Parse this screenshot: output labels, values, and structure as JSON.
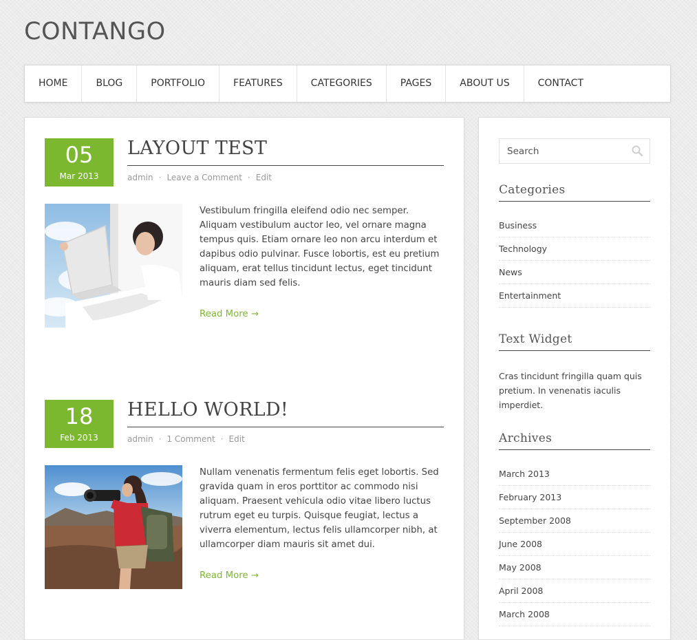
{
  "site": {
    "title": "CONTANGO"
  },
  "nav": {
    "items": [
      "HOME",
      "BLOG",
      "PORTFOLIO",
      "FEATURES",
      "CATEGORIES",
      "PAGES",
      "ABOUT US",
      "CONTACT"
    ]
  },
  "colors": {
    "accent": "#7cb82f",
    "text": "#444444",
    "background": "#ececec"
  },
  "posts": [
    {
      "day": "05",
      "month": "Mar 2013",
      "title": "LAYOUT TEST",
      "author": "admin",
      "comments": "Leave a Comment",
      "edit": "Edit",
      "excerpt": "Vestibulum fringilla eleifend odio nec semper. Aliquam vestibulum auctor leo, vel ornare magna tempus quis. Etiam ornare leo non arcu interdum et dapibus odio pulvinar. Fusce lobortis, est eu pretium aliquam, erat tellus tincidunt lectus, eget tincidunt mauris diam sed felis.",
      "read_more": "Read More →"
    },
    {
      "day": "18",
      "month": "Feb 2013",
      "title": "HELLO WORLD!",
      "author": "admin",
      "comments": "1 Comment",
      "edit": "Edit",
      "excerpt": "Nullam venenatis fermentum felis eget lobortis. Sed gravida quam in eros porttitor ac commodo nisi aliquam. Praesent vehicula odio vitae libero luctus rutrum eget eu turpis. Quisque feugiat, lectus a viverra elementum, lectus felis ullamcorper nibh, at ullamcorper diam mauris sit amet dui.",
      "read_more": "Read More →"
    }
  ],
  "sidebar": {
    "search": {
      "placeholder": "Search"
    },
    "categories": {
      "title": "Categories",
      "items": [
        "Business",
        "Technology",
        "News",
        "Entertainment"
      ]
    },
    "text_widget": {
      "title": "Text Widget",
      "text": "Cras tincidunt fringilla quam quis pretium. In venenatis iaculis imperdiet."
    },
    "archives": {
      "title": "Archives",
      "items": [
        "March 2013",
        "February 2013",
        "September 2008",
        "June 2008",
        "May 2008",
        "April 2008",
        "March 2008"
      ]
    }
  }
}
